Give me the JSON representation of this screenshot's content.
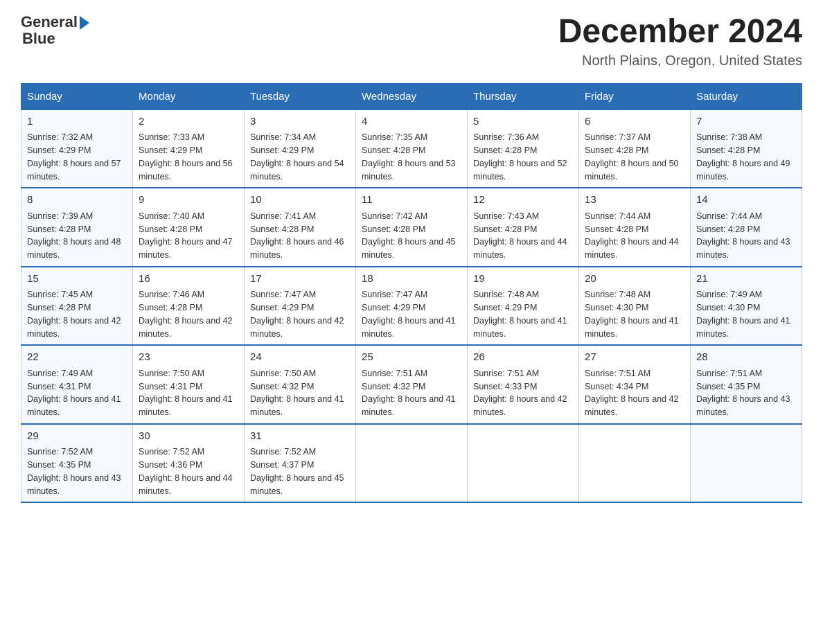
{
  "logo": {
    "line1": "General",
    "arrow": true,
    "line2": "Blue"
  },
  "header": {
    "month": "December 2024",
    "location": "North Plains, Oregon, United States"
  },
  "days_of_week": [
    "Sunday",
    "Monday",
    "Tuesday",
    "Wednesday",
    "Thursday",
    "Friday",
    "Saturday"
  ],
  "weeks": [
    [
      {
        "day": "1",
        "sunrise": "7:32 AM",
        "sunset": "4:29 PM",
        "daylight": "8 hours and 57 minutes."
      },
      {
        "day": "2",
        "sunrise": "7:33 AM",
        "sunset": "4:29 PM",
        "daylight": "8 hours and 56 minutes."
      },
      {
        "day": "3",
        "sunrise": "7:34 AM",
        "sunset": "4:29 PM",
        "daylight": "8 hours and 54 minutes."
      },
      {
        "day": "4",
        "sunrise": "7:35 AM",
        "sunset": "4:28 PM",
        "daylight": "8 hours and 53 minutes."
      },
      {
        "day": "5",
        "sunrise": "7:36 AM",
        "sunset": "4:28 PM",
        "daylight": "8 hours and 52 minutes."
      },
      {
        "day": "6",
        "sunrise": "7:37 AM",
        "sunset": "4:28 PM",
        "daylight": "8 hours and 50 minutes."
      },
      {
        "day": "7",
        "sunrise": "7:38 AM",
        "sunset": "4:28 PM",
        "daylight": "8 hours and 49 minutes."
      }
    ],
    [
      {
        "day": "8",
        "sunrise": "7:39 AM",
        "sunset": "4:28 PM",
        "daylight": "8 hours and 48 minutes."
      },
      {
        "day": "9",
        "sunrise": "7:40 AM",
        "sunset": "4:28 PM",
        "daylight": "8 hours and 47 minutes."
      },
      {
        "day": "10",
        "sunrise": "7:41 AM",
        "sunset": "4:28 PM",
        "daylight": "8 hours and 46 minutes."
      },
      {
        "day": "11",
        "sunrise": "7:42 AM",
        "sunset": "4:28 PM",
        "daylight": "8 hours and 45 minutes."
      },
      {
        "day": "12",
        "sunrise": "7:43 AM",
        "sunset": "4:28 PM",
        "daylight": "8 hours and 44 minutes."
      },
      {
        "day": "13",
        "sunrise": "7:44 AM",
        "sunset": "4:28 PM",
        "daylight": "8 hours and 44 minutes."
      },
      {
        "day": "14",
        "sunrise": "7:44 AM",
        "sunset": "4:28 PM",
        "daylight": "8 hours and 43 minutes."
      }
    ],
    [
      {
        "day": "15",
        "sunrise": "7:45 AM",
        "sunset": "4:28 PM",
        "daylight": "8 hours and 42 minutes."
      },
      {
        "day": "16",
        "sunrise": "7:46 AM",
        "sunset": "4:28 PM",
        "daylight": "8 hours and 42 minutes."
      },
      {
        "day": "17",
        "sunrise": "7:47 AM",
        "sunset": "4:29 PM",
        "daylight": "8 hours and 42 minutes."
      },
      {
        "day": "18",
        "sunrise": "7:47 AM",
        "sunset": "4:29 PM",
        "daylight": "8 hours and 41 minutes."
      },
      {
        "day": "19",
        "sunrise": "7:48 AM",
        "sunset": "4:29 PM",
        "daylight": "8 hours and 41 minutes."
      },
      {
        "day": "20",
        "sunrise": "7:48 AM",
        "sunset": "4:30 PM",
        "daylight": "8 hours and 41 minutes."
      },
      {
        "day": "21",
        "sunrise": "7:49 AM",
        "sunset": "4:30 PM",
        "daylight": "8 hours and 41 minutes."
      }
    ],
    [
      {
        "day": "22",
        "sunrise": "7:49 AM",
        "sunset": "4:31 PM",
        "daylight": "8 hours and 41 minutes."
      },
      {
        "day": "23",
        "sunrise": "7:50 AM",
        "sunset": "4:31 PM",
        "daylight": "8 hours and 41 minutes."
      },
      {
        "day": "24",
        "sunrise": "7:50 AM",
        "sunset": "4:32 PM",
        "daylight": "8 hours and 41 minutes."
      },
      {
        "day": "25",
        "sunrise": "7:51 AM",
        "sunset": "4:32 PM",
        "daylight": "8 hours and 41 minutes."
      },
      {
        "day": "26",
        "sunrise": "7:51 AM",
        "sunset": "4:33 PM",
        "daylight": "8 hours and 42 minutes."
      },
      {
        "day": "27",
        "sunrise": "7:51 AM",
        "sunset": "4:34 PM",
        "daylight": "8 hours and 42 minutes."
      },
      {
        "day": "28",
        "sunrise": "7:51 AM",
        "sunset": "4:35 PM",
        "daylight": "8 hours and 43 minutes."
      }
    ],
    [
      {
        "day": "29",
        "sunrise": "7:52 AM",
        "sunset": "4:35 PM",
        "daylight": "8 hours and 43 minutes."
      },
      {
        "day": "30",
        "sunrise": "7:52 AM",
        "sunset": "4:36 PM",
        "daylight": "8 hours and 44 minutes."
      },
      {
        "day": "31",
        "sunrise": "7:52 AM",
        "sunset": "4:37 PM",
        "daylight": "8 hours and 45 minutes."
      },
      null,
      null,
      null,
      null
    ]
  ],
  "labels": {
    "sunrise_prefix": "Sunrise: ",
    "sunset_prefix": "Sunset: ",
    "daylight_prefix": "Daylight: "
  }
}
